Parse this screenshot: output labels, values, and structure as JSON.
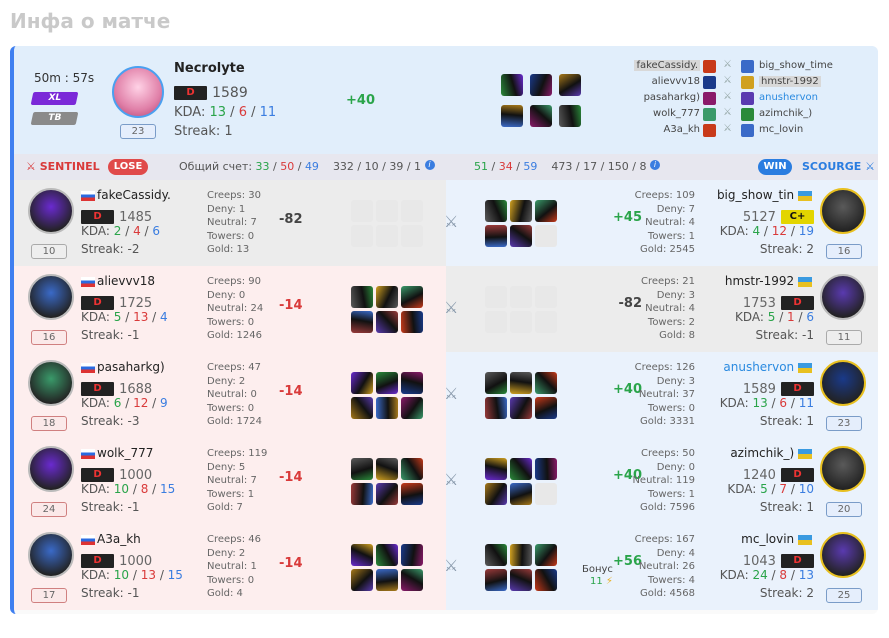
{
  "page_title": "Инфа о матче",
  "hero": {
    "duration": "50m : 57s",
    "mode1": "XL",
    "mode2": "TB",
    "level": "23",
    "name": "Necrolyte",
    "rank": "D",
    "rating": "1589",
    "kda_label": "KDA:",
    "kills": "13",
    "deaths": "6",
    "assists": "11",
    "streak": "Streak: 1",
    "delta": "+40"
  },
  "matchups": [
    {
      "left": "fakeCassidy.",
      "right": "big_show_time"
    },
    {
      "left": "alievvv18",
      "right": "hmstr-1992"
    },
    {
      "left": "pasaharkg)",
      "right": "anushervon"
    },
    {
      "left": "wolk_777",
      "right": "azimchik_)"
    },
    {
      "left": "A3a_kh",
      "right": "mc_lovin"
    }
  ],
  "bar": {
    "sentinel": "SENTINEL",
    "lose": "LOSE",
    "score_label": "Общий счет:",
    "s_k": "33",
    "s_d": "50",
    "s_a": "49",
    "s_cdn": "332 / 10 / 39 / 1",
    "sc_k": "51",
    "sc_d": "34",
    "sc_a": "59",
    "sc_cdn": "473 / 17 / 150 / 8",
    "win": "WIN",
    "scourge": "SCOURGE"
  },
  "players_left": [
    {
      "name": "fakeCassidy.",
      "rank": "D",
      "rating": "1485",
      "k": "2",
      "d": "4",
      "a": "6",
      "streak": "Streak: -2",
      "level": "10",
      "creeps": "Creeps: 30",
      "deny": "Deny: 1",
      "neutral": "Neutral: 7",
      "towers": "Towers: 0",
      "gold": "Gold: 13",
      "delta": "-82"
    },
    {
      "name": "alievvv18",
      "rank": "D",
      "rating": "1725",
      "k": "5",
      "d": "13",
      "a": "4",
      "streak": "Streak: -1",
      "level": "16",
      "creeps": "Creeps: 90",
      "deny": "Deny: 0",
      "neutral": "Neutral: 24",
      "towers": "Towers: 0",
      "gold": "Gold: 1246",
      "delta": "-14"
    },
    {
      "name": "pasaharkg)",
      "rank": "D",
      "rating": "1688",
      "k": "6",
      "d": "12",
      "a": "9",
      "streak": "Streak: -3",
      "level": "18",
      "creeps": "Creeps: 47",
      "deny": "Deny: 2",
      "neutral": "Neutral: 0",
      "towers": "Towers: 0",
      "gold": "Gold: 1724",
      "delta": "-14"
    },
    {
      "name": "wolk_777",
      "rank": "D",
      "rating": "1000",
      "k": "10",
      "d": "8",
      "a": "15",
      "streak": "Streak: -1",
      "level": "24",
      "creeps": "Creeps: 119",
      "deny": "Deny: 5",
      "neutral": "Neutral: 7",
      "towers": "Towers: 1",
      "gold": "Gold: 7",
      "delta": "-14"
    },
    {
      "name": "A3a_kh",
      "rank": "D",
      "rating": "1000",
      "k": "10",
      "d": "13",
      "a": "15",
      "streak": "Streak: -1",
      "level": "17",
      "creeps": "Creeps: 46",
      "deny": "Deny: 2",
      "neutral": "Neutral: 1",
      "towers": "Towers: 0",
      "gold": "Gold: 4",
      "delta": "-14"
    }
  ],
  "players_right": [
    {
      "name": "big_show_tin",
      "rank": "C+",
      "rating": "5127",
      "k": "4",
      "d": "12",
      "a": "19",
      "streak": "Streak: 2",
      "level": "16",
      "creeps": "Creeps: 109",
      "deny": "Deny: 7",
      "neutral": "Neutral: 4",
      "towers": "Towers: 1",
      "gold": "Gold: 2545",
      "delta": "+45"
    },
    {
      "name": "hmstr-1992",
      "rank": "D",
      "rating": "1753",
      "k": "5",
      "d": "1",
      "a": "6",
      "streak": "Streak: -1",
      "level": "11",
      "creeps": "Creeps: 21",
      "deny": "Deny: 3",
      "neutral": "Neutral: 4",
      "towers": "Towers: 2",
      "gold": "Gold: 8",
      "delta": "-82"
    },
    {
      "name": "anushervon",
      "rank": "D",
      "rating": "1589",
      "k": "13",
      "d": "6",
      "a": "11",
      "streak": "Streak: 1",
      "level": "23",
      "creeps": "Creeps: 126",
      "deny": "Deny: 3",
      "neutral": "Neutral: 37",
      "towers": "Towers: 0",
      "gold": "Gold: 3331",
      "delta": "+40"
    },
    {
      "name": "azimchik_)",
      "rank": "D",
      "rating": "1240",
      "k": "5",
      "d": "7",
      "a": "10",
      "streak": "Streak: 1",
      "level": "20",
      "creeps": "Creeps: 50",
      "deny": "Deny: 0",
      "neutral": "Neutral: 119",
      "towers": "Towers: 1",
      "gold": "Gold: 7596",
      "delta": "+40"
    },
    {
      "name": "mc_lovin",
      "rank": "D",
      "rating": "1043",
      "k": "24",
      "d": "8",
      "a": "13",
      "streak": "Streak: 2",
      "level": "25",
      "creeps": "Creeps: 167",
      "deny": "Deny: 4",
      "neutral": "Neutral: 26",
      "towers": "Towers: 4",
      "gold": "Gold: 4568",
      "delta": "+56",
      "bonus_label": "Бонус",
      "bonus": "11"
    }
  ]
}
